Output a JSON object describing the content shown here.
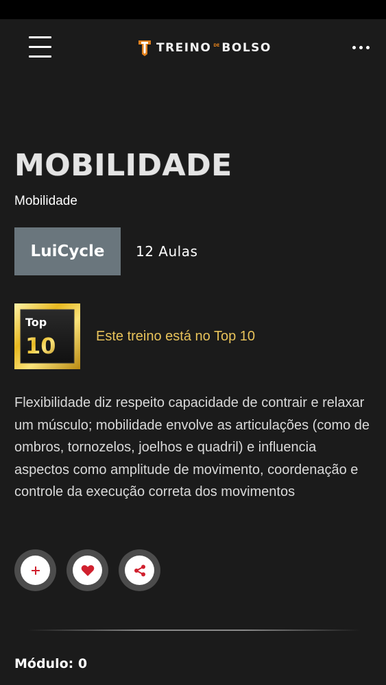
{
  "header": {
    "brand_main": "TREINO",
    "brand_small": "DE",
    "brand_end": "BOLSO"
  },
  "page": {
    "title": "MOBILIDADE",
    "subtitle": "Mobilidade"
  },
  "instructor": {
    "name": "LuiCycle"
  },
  "lessons": {
    "count_label": "12 Aulas"
  },
  "badge": {
    "top_label": "Top",
    "number": "10",
    "message": "Este treino está no Top 10"
  },
  "description": "Flexibilidade diz respeito capacidade de contrair e relaxar um músculo; mobilidade envolve as articulações (como de ombros, tornozelos, joelhos e quadril) e influencia aspectos como amplitude de movimento, coordenação e controle da execução correta dos movimentos",
  "actions": [
    {
      "icon": "plus-icon",
      "color": "#d0202e"
    },
    {
      "icon": "heart-icon",
      "color": "#d0202e"
    },
    {
      "icon": "share-icon",
      "color": "#d0202e"
    }
  ],
  "module": {
    "label": "Módulo: 0"
  },
  "colors": {
    "background": "#1b1b1b",
    "accent_gold": "#e8c35a",
    "badge_gray": "#6a767d",
    "brand_orange": "#e0801c"
  }
}
